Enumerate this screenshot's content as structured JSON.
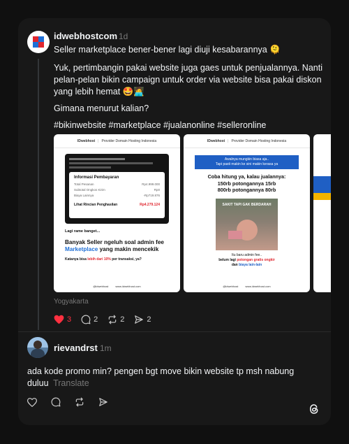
{
  "post": {
    "username": "idwebhostcom",
    "time": "1d",
    "line1": "Seller marketplace bener-bener lagi diuji kesabarannya 🫠",
    "para2_l1": "Yuk, pertimbangin pakai website juga gaes untuk penjualannya. Nanti",
    "para2_l2": "pelan-pelan bikin campaign untuk order via website bisa pakai diskon",
    "para2_l3": "yang lebih hemat 🤩🧑‍💻",
    "question": "Gimana menurut kalian?",
    "hashtags": "#bikinwebsite #marketplace #jualanonline #selleronline",
    "location": "Yogyakarta",
    "likes": "3",
    "replies": "2",
    "reposts": "2",
    "shares": "2"
  },
  "image1": {
    "brand": "IDwebhost",
    "brand_sub": "Provider Domain Hosting Indonesia",
    "panel_title": "Informasi Pembayaran",
    "rows": [
      {
        "label": "Total Pesanan",
        "value": "Rp4.999.000"
      },
      {
        "label": "Subtotal Ongkos Kirim",
        "value": "Rp0"
      },
      {
        "label": "Biaya Lainnya",
        "value": "-Rp719.876"
      }
    ],
    "rincian_label": "Lihat Rincian Penghasilan",
    "rincian_value": "Rp4.279.124",
    "note": "Lagi rame banget...",
    "headline_1": "Banyak Seller ngeluh soal admin fee",
    "headline_2a": "Marketplace",
    "headline_2b": " yang makin mencekik",
    "sub_1": "Katanya bisa ",
    "sub_hl": "lebih dari 10%",
    "sub_2": " per transaksi, ya?",
    "follow": "@idwebhost",
    "site": "www.idwebhost.com"
  },
  "image2": {
    "brand": "IDwebhost",
    "brand_sub": "Provider Domain Hosting Indonesia",
    "banner_1": "Awalnya mungkin biasa aja..",
    "banner_2": "Tapi pasti makin ke sini makin kerasa ya",
    "h_1": "Coba hitung ya, kalau jualannya:",
    "h_2": "150rb potongannya 15rb",
    "h_3": "800rb potongannya 80rb",
    "meme": "SAKIT TAPI GAK BERDARAH",
    "f_1": "Itu baru admin fee..",
    "f_2a": "belum lagi ",
    "f_2b": "potongan gratis ongkir",
    "f_3a": "dan ",
    "f_3b": "biaya lain-lain",
    "follow": "@idwebhost",
    "site": "www.idwebhost.com"
  },
  "reply": {
    "username": "rievandrst",
    "time": "1m",
    "line1": "ada kode promo min? pengen bgt move bikin website tp msh nabung",
    "line2": "duluu",
    "translate": "Translate"
  },
  "colors": {
    "like_red": "#ff3040",
    "accent_blue": "#1f6fd6",
    "accent_red": "#e0262e",
    "background": "#101010",
    "card": "#181818"
  }
}
